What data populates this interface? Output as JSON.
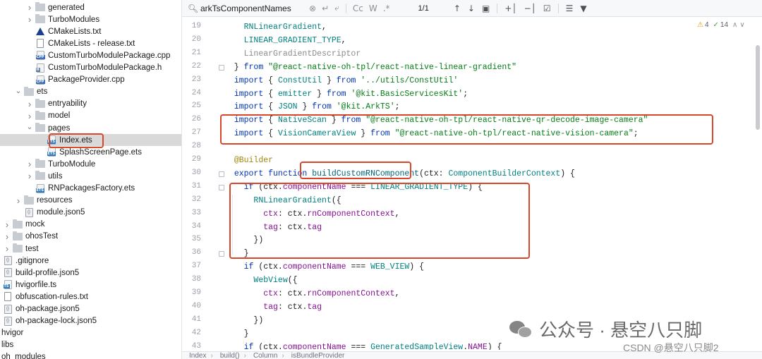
{
  "tree": {
    "items": [
      {
        "label": "generated",
        "kind": "folder",
        "depth": 2,
        "expand": "closed"
      },
      {
        "label": "TurboModules",
        "kind": "folder",
        "depth": 2,
        "expand": "closed"
      },
      {
        "label": "CMakeLists.txt",
        "kind": "cmake",
        "depth": 2,
        "expand": "none"
      },
      {
        "label": "CMakeLists - release.txt",
        "kind": "doc",
        "depth": 2,
        "expand": "none"
      },
      {
        "label": "CustomTurboModulePackage.cpp",
        "kind": "cpp",
        "depth": 2,
        "expand": "none"
      },
      {
        "label": "CustomTurboModulePackage.h",
        "kind": "h",
        "depth": 2,
        "expand": "none"
      },
      {
        "label": "PackageProvider.cpp",
        "kind": "cpp",
        "depth": 2,
        "expand": "none"
      },
      {
        "label": "ets",
        "kind": "folder",
        "depth": 1,
        "expand": "open"
      },
      {
        "label": "entryability",
        "kind": "folder",
        "depth": 2,
        "expand": "closed"
      },
      {
        "label": "model",
        "kind": "folder",
        "depth": 2,
        "expand": "closed"
      },
      {
        "label": "pages",
        "kind": "folder",
        "depth": 2,
        "expand": "open"
      },
      {
        "label": "Index.ets",
        "kind": "ets",
        "depth": 3,
        "expand": "none",
        "selected": true
      },
      {
        "label": "SplashScreenPage.ets",
        "kind": "ets",
        "depth": 3,
        "expand": "none"
      },
      {
        "label": "TurboModule",
        "kind": "folder",
        "depth": 2,
        "expand": "closed"
      },
      {
        "label": "utils",
        "kind": "folder",
        "depth": 2,
        "expand": "closed"
      },
      {
        "label": "RNPackagesFactory.ets",
        "kind": "ets",
        "depth": 2,
        "expand": "none"
      },
      {
        "label": "resources",
        "kind": "folder",
        "depth": 1,
        "expand": "closed"
      },
      {
        "label": "module.json5",
        "kind": "json",
        "depth": 1,
        "expand": "none"
      },
      {
        "label": "mock",
        "kind": "folder",
        "depth": 0,
        "expand": "closed"
      },
      {
        "label": "ohosTest",
        "kind": "folder",
        "depth": 0,
        "expand": "closed"
      },
      {
        "label": "test",
        "kind": "folder",
        "depth": 0,
        "expand": "closed"
      },
      {
        "label": ".gitignore",
        "kind": "json",
        "depth": -1,
        "expand": "none"
      },
      {
        "label": "build-profile.json5",
        "kind": "json",
        "depth": -1,
        "expand": "none"
      },
      {
        "label": "hvigorfile.ts",
        "kind": "ts",
        "depth": -1,
        "expand": "none"
      },
      {
        "label": "obfuscation-rules.txt",
        "kind": "doc",
        "depth": -1,
        "expand": "none"
      },
      {
        "label": "oh-package.json5",
        "kind": "json",
        "depth": -1,
        "expand": "none"
      },
      {
        "label": "oh-package-lock.json5",
        "kind": "json",
        "depth": -1,
        "expand": "none"
      },
      {
        "label": "hvigor",
        "kind": "plain",
        "depth": -2,
        "expand": "none"
      },
      {
        "label": "libs",
        "kind": "plain",
        "depth": -2,
        "expand": "none"
      },
      {
        "label": "oh_modules",
        "kind": "plain",
        "depth": -2,
        "expand": "none"
      }
    ]
  },
  "search": {
    "query": "arkTsComponentNames",
    "match_count": "1/1",
    "case_label": "Cc",
    "word_label": "W",
    "regex_label": ".*"
  },
  "inspection": {
    "warnings": "4",
    "checks": "14"
  },
  "code": {
    "lines": [
      {
        "n": "19",
        "tokens": [
          [
            "    ",
            ""
          ],
          [
            "RNLinearGradient",
            "cls"
          ],
          [
            ",",
            ""
          ]
        ]
      },
      {
        "n": "20",
        "tokens": [
          [
            "    ",
            ""
          ],
          [
            "LINEAR_GRADIENT_TYPE",
            "cls"
          ],
          [
            ",",
            ""
          ]
        ]
      },
      {
        "n": "21",
        "tokens": [
          [
            "    ",
            ""
          ],
          [
            "LinearGradientDescriptor",
            "dim"
          ]
        ]
      },
      {
        "n": "22",
        "tokens": [
          [
            "  } ",
            ""
          ],
          [
            "from ",
            "kw"
          ],
          [
            "\"@react-native-oh-tpl/react-native-linear-gradient\"",
            "str"
          ]
        ]
      },
      {
        "n": "23",
        "tokens": [
          [
            "  ",
            ""
          ],
          [
            "import ",
            "kw"
          ],
          [
            "{ ",
            ""
          ],
          [
            "ConstUtil ",
            "cls"
          ],
          [
            "} ",
            ""
          ],
          [
            "from ",
            "kw"
          ],
          [
            "'../utils/ConstUtil'",
            "str"
          ]
        ]
      },
      {
        "n": "24",
        "tokens": [
          [
            "  ",
            ""
          ],
          [
            "import ",
            "kw"
          ],
          [
            "{ ",
            ""
          ],
          [
            "emitter ",
            "cls"
          ],
          [
            "} ",
            ""
          ],
          [
            "from ",
            "kw"
          ],
          [
            "'@kit.BasicServicesKit'",
            "str"
          ],
          [
            ";",
            ""
          ]
        ]
      },
      {
        "n": "25",
        "tokens": [
          [
            "  ",
            ""
          ],
          [
            "import ",
            "kw"
          ],
          [
            "{ ",
            ""
          ],
          [
            "JSON ",
            "cls"
          ],
          [
            "} ",
            ""
          ],
          [
            "from ",
            "kw"
          ],
          [
            "'@kit.ArkTS'",
            "str"
          ],
          [
            ";",
            ""
          ]
        ]
      },
      {
        "n": "26",
        "tokens": [
          [
            "  ",
            ""
          ],
          [
            "import ",
            "kw"
          ],
          [
            "{ ",
            ""
          ],
          [
            "NativeScan ",
            "cls"
          ],
          [
            "} ",
            ""
          ],
          [
            "from ",
            "kw"
          ],
          [
            "\"@react-native-oh-tpl/react-native-qr-decode-image-camera\"",
            "str"
          ]
        ]
      },
      {
        "n": "27",
        "tokens": [
          [
            "  ",
            ""
          ],
          [
            "import ",
            "kw"
          ],
          [
            "{ ",
            ""
          ],
          [
            "VisionCameraView ",
            "cls"
          ],
          [
            "} ",
            ""
          ],
          [
            "from ",
            "kw"
          ],
          [
            "\"@react-native-oh-tpl/react-native-vision-camera\"",
            "str"
          ],
          [
            ";",
            ""
          ]
        ]
      },
      {
        "n": "28",
        "tokens": [
          [
            "",
            ""
          ]
        ]
      },
      {
        "n": "29",
        "tokens": [
          [
            "  ",
            ""
          ],
          [
            "@Builder",
            "ann"
          ]
        ]
      },
      {
        "n": "30",
        "tokens": [
          [
            "  ",
            ""
          ],
          [
            "export ",
            "kw"
          ],
          [
            "function ",
            "kw"
          ],
          [
            "buildCustomRNComponent",
            "fn"
          ],
          [
            "(ctx: ",
            ""
          ],
          [
            "ComponentBuilderContext",
            "cls"
          ],
          [
            ") {",
            ""
          ]
        ]
      },
      {
        "n": "31",
        "tokens": [
          [
            "    ",
            ""
          ],
          [
            "if ",
            "kw"
          ],
          [
            "(ctx.",
            ""
          ],
          [
            "componentName ",
            "prop"
          ],
          [
            "=== ",
            ""
          ],
          [
            "LINEAR_GRADIENT_TYPE",
            "cls"
          ],
          [
            ") {",
            ""
          ]
        ]
      },
      {
        "n": "32",
        "tokens": [
          [
            "      ",
            ""
          ],
          [
            "RNLinearGradient",
            "cls"
          ],
          [
            "({",
            ""
          ]
        ]
      },
      {
        "n": "33",
        "tokens": [
          [
            "        ",
            ""
          ],
          [
            "ctx",
            "prop"
          ],
          [
            ": ctx.",
            ""
          ],
          [
            "rnComponentContext",
            "prop"
          ],
          [
            ",",
            ""
          ]
        ]
      },
      {
        "n": "34",
        "tokens": [
          [
            "        ",
            ""
          ],
          [
            "tag",
            "prop"
          ],
          [
            ": ctx.",
            ""
          ],
          [
            "tag",
            "prop"
          ]
        ]
      },
      {
        "n": "35",
        "tokens": [
          [
            "      ",
            ""
          ],
          [
            "})",
            ""
          ]
        ]
      },
      {
        "n": "36",
        "tokens": [
          [
            "    ",
            ""
          ],
          [
            "}",
            ""
          ]
        ]
      },
      {
        "n": "37",
        "tokens": [
          [
            "    ",
            ""
          ],
          [
            "if ",
            "kw"
          ],
          [
            "(ctx.",
            ""
          ],
          [
            "componentName ",
            "prop"
          ],
          [
            "=== ",
            ""
          ],
          [
            "WEB_VIEW",
            "cls"
          ],
          [
            ") {",
            ""
          ]
        ]
      },
      {
        "n": "38",
        "tokens": [
          [
            "      ",
            ""
          ],
          [
            "WebView",
            "cls"
          ],
          [
            "({",
            ""
          ]
        ]
      },
      {
        "n": "39",
        "tokens": [
          [
            "        ",
            ""
          ],
          [
            "ctx",
            "prop"
          ],
          [
            ": ctx.",
            ""
          ],
          [
            "rnComponentContext",
            "prop"
          ],
          [
            ",",
            ""
          ]
        ]
      },
      {
        "n": "40",
        "tokens": [
          [
            "        ",
            ""
          ],
          [
            "tag",
            "prop"
          ],
          [
            ": ctx.",
            ""
          ],
          [
            "tag",
            "prop"
          ]
        ]
      },
      {
        "n": "41",
        "tokens": [
          [
            "      ",
            ""
          ],
          [
            "})",
            ""
          ]
        ]
      },
      {
        "n": "42",
        "tokens": [
          [
            "    ",
            ""
          ],
          [
            "}",
            ""
          ]
        ]
      },
      {
        "n": "43",
        "tokens": [
          [
            "    ",
            ""
          ],
          [
            "if ",
            "kw"
          ],
          [
            "(ctx.",
            ""
          ],
          [
            "componentName ",
            "prop"
          ],
          [
            "=== ",
            ""
          ],
          [
            "GeneratedSampleView",
            "cls"
          ],
          [
            ".",
            ""
          ],
          [
            "NAME",
            "prop"
          ],
          [
            ") {",
            ""
          ]
        ]
      }
    ]
  },
  "breadcrumbs": [
    "Index",
    "build()",
    "Column",
    "isBundleProvider"
  ],
  "watermark": {
    "primary": "公众号 · 悬空八只脚",
    "secondary": "CSDN @悬空八只脚2"
  },
  "colors": {
    "highlight": "#d9472b",
    "selection": "#d9d9d9"
  }
}
